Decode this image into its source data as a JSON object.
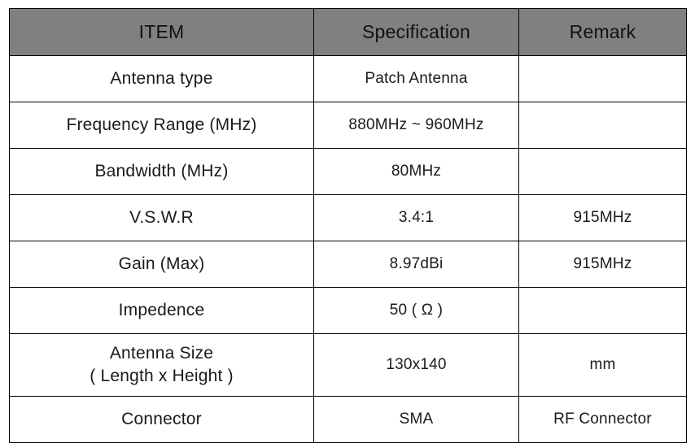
{
  "table": {
    "name": "antenna-specification-table",
    "header_background": "#808080",
    "border_color": "#000000",
    "columns": [
      {
        "key": "item",
        "label": "ITEM"
      },
      {
        "key": "spec",
        "label": "Specification"
      },
      {
        "key": "remark",
        "label": "Remark"
      }
    ],
    "rows": [
      {
        "item": "Antenna type",
        "item_line2": "",
        "spec": "Patch Antenna",
        "remark": ""
      },
      {
        "item": "Frequency Range (MHz)",
        "item_line2": "",
        "spec": "880MHz ~ 960MHz",
        "remark": ""
      },
      {
        "item": "Bandwidth (MHz)",
        "item_line2": "",
        "spec": "80MHz",
        "remark": ""
      },
      {
        "item": "V.S.W.R",
        "item_line2": "",
        "spec": "3.4:1",
        "remark": "915MHz"
      },
      {
        "item": "Gain (Max)",
        "item_line2": "",
        "spec": "8.97dBi",
        "remark": "915MHz"
      },
      {
        "item": "Impedence",
        "item_line2": "",
        "spec": "50 ( Ω )",
        "remark": ""
      },
      {
        "item": "Antenna Size",
        "item_line2": "( Length x Height )",
        "spec": "130x140",
        "remark": "mm"
      },
      {
        "item": "Connector",
        "item_line2": "",
        "spec": "SMA",
        "remark": "RF Connector"
      }
    ]
  }
}
